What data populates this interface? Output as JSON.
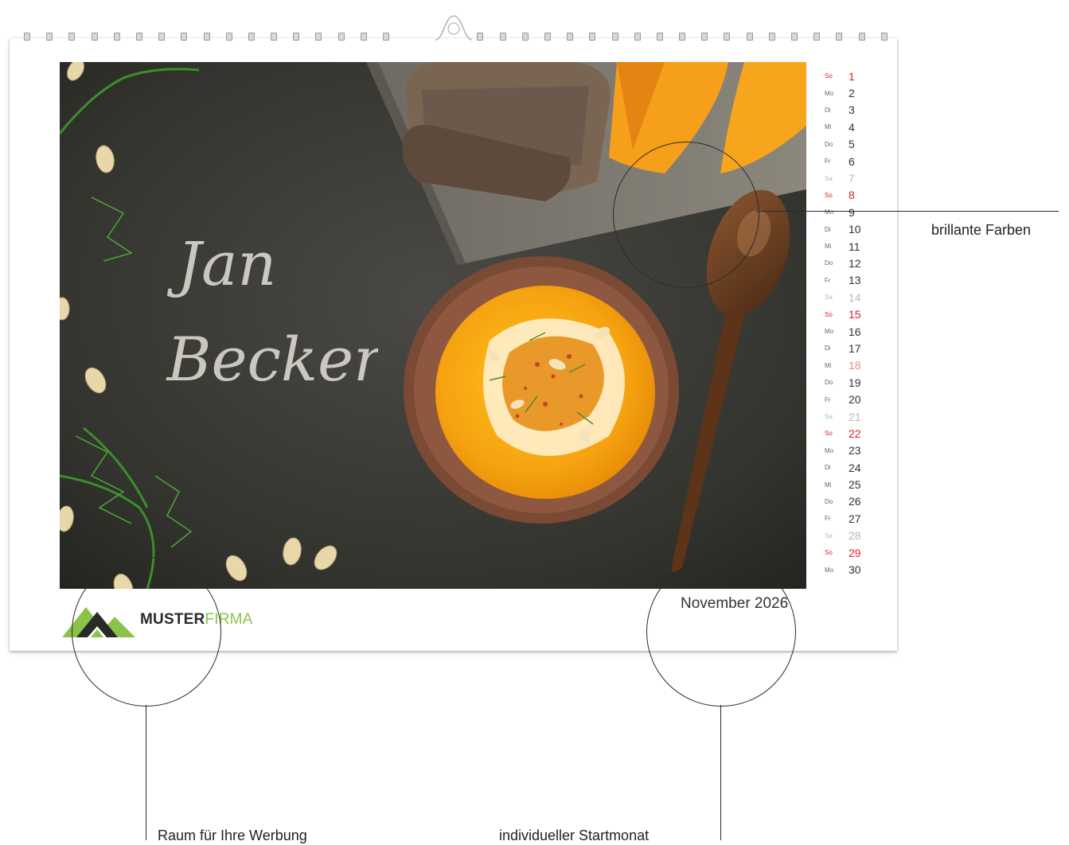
{
  "calendar": {
    "month_label": "November 2026",
    "days": [
      {
        "weekday": "So",
        "day": "1",
        "type": "sun"
      },
      {
        "weekday": "Mo",
        "day": "2",
        "type": "week"
      },
      {
        "weekday": "Di",
        "day": "3",
        "type": "week"
      },
      {
        "weekday": "Mi",
        "day": "4",
        "type": "week"
      },
      {
        "weekday": "Do",
        "day": "5",
        "type": "week"
      },
      {
        "weekday": "Fr",
        "day": "6",
        "type": "week"
      },
      {
        "weekday": "Sa",
        "day": "7",
        "type": "sat"
      },
      {
        "weekday": "So",
        "day": "8",
        "type": "sun"
      },
      {
        "weekday": "Mo",
        "day": "9",
        "type": "week"
      },
      {
        "weekday": "Di",
        "day": "10",
        "type": "week"
      },
      {
        "weekday": "Mi",
        "day": "11",
        "type": "week"
      },
      {
        "weekday": "Do",
        "day": "12",
        "type": "week"
      },
      {
        "weekday": "Fr",
        "day": "13",
        "type": "week"
      },
      {
        "weekday": "Sa",
        "day": "14",
        "type": "sat"
      },
      {
        "weekday": "So",
        "day": "15",
        "type": "sun"
      },
      {
        "weekday": "Mo",
        "day": "16",
        "type": "week"
      },
      {
        "weekday": "Di",
        "day": "17",
        "type": "week"
      },
      {
        "weekday": "Mi",
        "day": "18",
        "type": "holiday"
      },
      {
        "weekday": "Do",
        "day": "19",
        "type": "week"
      },
      {
        "weekday": "Fr",
        "day": "20",
        "type": "week"
      },
      {
        "weekday": "Sa",
        "day": "21",
        "type": "sat"
      },
      {
        "weekday": "So",
        "day": "22",
        "type": "sun"
      },
      {
        "weekday": "Mo",
        "day": "23",
        "type": "week"
      },
      {
        "weekday": "Di",
        "day": "24",
        "type": "week"
      },
      {
        "weekday": "Mi",
        "day": "25",
        "type": "week"
      },
      {
        "weekday": "Do",
        "day": "26",
        "type": "week"
      },
      {
        "weekday": "Fr",
        "day": "27",
        "type": "week"
      },
      {
        "weekday": "Sa",
        "day": "28",
        "type": "sat"
      },
      {
        "weekday": "So",
        "day": "29",
        "type": "sun"
      },
      {
        "weekday": "Mo",
        "day": "30",
        "type": "week"
      }
    ]
  },
  "photo": {
    "script_line1": "Jan",
    "script_line2": "Becker",
    "description_icon": "soup-bowl-photo"
  },
  "logo": {
    "word_bold": "MUSTER",
    "word_light": "FIRMA",
    "icon": "mountain-logo-icon",
    "accent_color": "#8bc34a"
  },
  "callouts": {
    "colors": "brillante Farben",
    "advertising": "Raum für Ihre Werbung",
    "start_month": "individueller Startmonat"
  },
  "colors": {
    "sunday": "#e0202a",
    "saturday": "#b7b7b7",
    "holiday": "#f08a74"
  }
}
